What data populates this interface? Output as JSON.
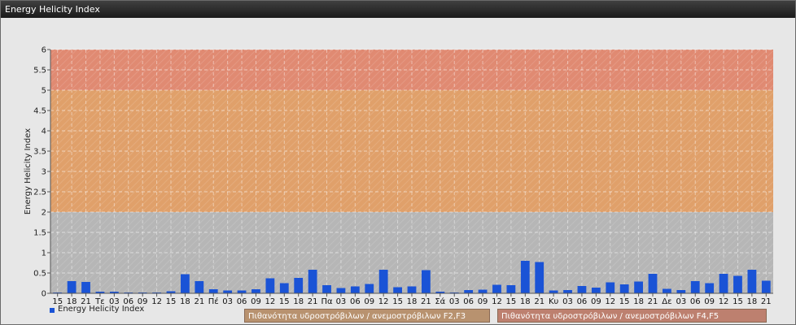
{
  "window": {
    "title": "Energy Helicity Index"
  },
  "chart_data": {
    "type": "bar",
    "ylabel": "Energy Helicity Index",
    "ylim": [
      0,
      6
    ],
    "yticks": [
      "0",
      "0.5",
      "1",
      "1.5",
      "2",
      "2.5",
      "3",
      "3.5",
      "4",
      "4.5",
      "5",
      "5.5",
      "6"
    ],
    "grid": true,
    "bands": [
      {
        "from": 0,
        "to": 2,
        "color": "#b6b6b6"
      },
      {
        "from": 2,
        "to": 5,
        "color": "#e0a06a"
      },
      {
        "from": 5,
        "to": 6,
        "color": "#e08a72"
      }
    ],
    "categories": [
      "15",
      "18",
      "21",
      "Τε",
      "03",
      "06",
      "09",
      "12",
      "15",
      "18",
      "21",
      "Πέ",
      "03",
      "06",
      "09",
      "12",
      "15",
      "18",
      "21",
      "Πα",
      "03",
      "06",
      "09",
      "12",
      "15",
      "18",
      "21",
      "Σά",
      "03",
      "06",
      "09",
      "12",
      "15",
      "18",
      "21",
      "Κυ",
      "03",
      "06",
      "09",
      "12",
      "15",
      "18",
      "21",
      "Δε",
      "03",
      "06",
      "09",
      "12",
      "15",
      "18",
      "21"
    ],
    "series": [
      {
        "name": "Energy Helicity Index",
        "color": "#1a53d6",
        "values": [
          0.02,
          0.3,
          0.28,
          0.04,
          0.04,
          0.02,
          0.02,
          0.02,
          0.05,
          0.47,
          0.3,
          0.1,
          0.07,
          0.07,
          0.1,
          0.37,
          0.25,
          0.38,
          0.58,
          0.2,
          0.13,
          0.17,
          0.23,
          0.58,
          0.15,
          0.17,
          0.57,
          0.04,
          0.02,
          0.08,
          0.09,
          0.21,
          0.2,
          0.8,
          0.77,
          0.07,
          0.08,
          0.18,
          0.14,
          0.27,
          0.22,
          0.29,
          0.48,
          0.11,
          0.08,
          0.3,
          0.25,
          0.48,
          0.43,
          0.58,
          0.31
        ]
      }
    ],
    "legend": {
      "label": "Energy Helicity Index",
      "position": "bottom-left"
    },
    "band_labels": [
      "Πιθανότητα υδροστρόβιλων / ανεμοστρόβιλων F2,F3",
      "Πιθανότητα υδροστρόβιλων / ανεμοστρόβιλων F4,F5"
    ]
  }
}
